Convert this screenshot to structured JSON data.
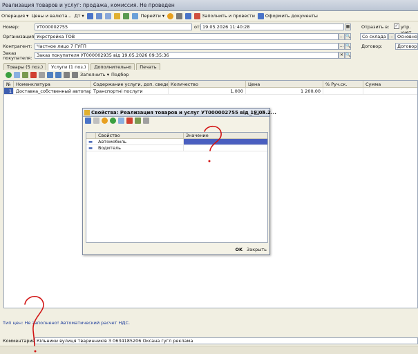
{
  "window": {
    "title": "Реализация товаров и услуг: продажа, комиссия. Не проведен"
  },
  "toolbar": {
    "operation": "Операция",
    "prices": "Цены и валюта...",
    "dt": "Дт",
    "goto": "Перейти",
    "fill_and_post": "Заполнить и провести",
    "print_docs": "Оформить документы"
  },
  "form": {
    "number_label": "Номер:",
    "number_value": "УТ000002755",
    "date_label": "от:",
    "date_value": "19.05.2026 11:40:28",
    "reflect_label": "Отразить в:",
    "reflect_check": "упр. учет",
    "org_label": "Организация:",
    "org_value": "Укрстройка ТОВ",
    "warehouse_value": "Со склада",
    "warehouse_main": "Основной",
    "contractor_label": "Контрагент:",
    "contractor_value": "Частное лицо 7 ГУГП",
    "contract_label": "Договор:",
    "contract_value": "Договор 2",
    "order_label1": "Заказ",
    "order_label2": "покупателя:",
    "order_value": "Заказ покупателя УТ000002935 від 19.05.2026 09:35:36"
  },
  "tabs": [
    {
      "label": "Товары (5 поз.)"
    },
    {
      "label": "Услуги (1 поз.)"
    },
    {
      "label": "Дополнительно"
    },
    {
      "label": "Печать"
    }
  ],
  "services_toolbar": {
    "fill": "Заполнить",
    "select": "Подбор"
  },
  "table": {
    "headers": [
      "№",
      "Номенклатура",
      "Содержание услуги, доп. сведения",
      "Количество",
      "Цена",
      "% Руч.ск.",
      "Сумма"
    ],
    "rows": [
      {
        "n": "1",
        "name": "Доставка_собственный автопарк",
        "content": "Транспортні послуги",
        "qty": "1,000",
        "price": "1 200,00",
        "disc": "",
        "sum": ""
      }
    ]
  },
  "footer": {
    "price_type": "Тип цен: Не заполнено! Автоматический расчет НДС.",
    "comment_label": "Комментарий:",
    "comment_value": "Кільники вулиця тваринників 3 0634185206 Оксана гугл реклама"
  },
  "dialog": {
    "title": "Свойства: Реализация товаров и услуг УТ000002755 від 19.05.2...",
    "col_property": "Свойство",
    "col_value": "Значение",
    "rows": [
      {
        "property": "Автомобиль",
        "value": ""
      },
      {
        "property": "Водитель",
        "value": ""
      }
    ],
    "ok": "OK",
    "close": "Закрыть"
  },
  "colors": {
    "accent": "#3f5fb0",
    "annotation": "#d21414"
  }
}
